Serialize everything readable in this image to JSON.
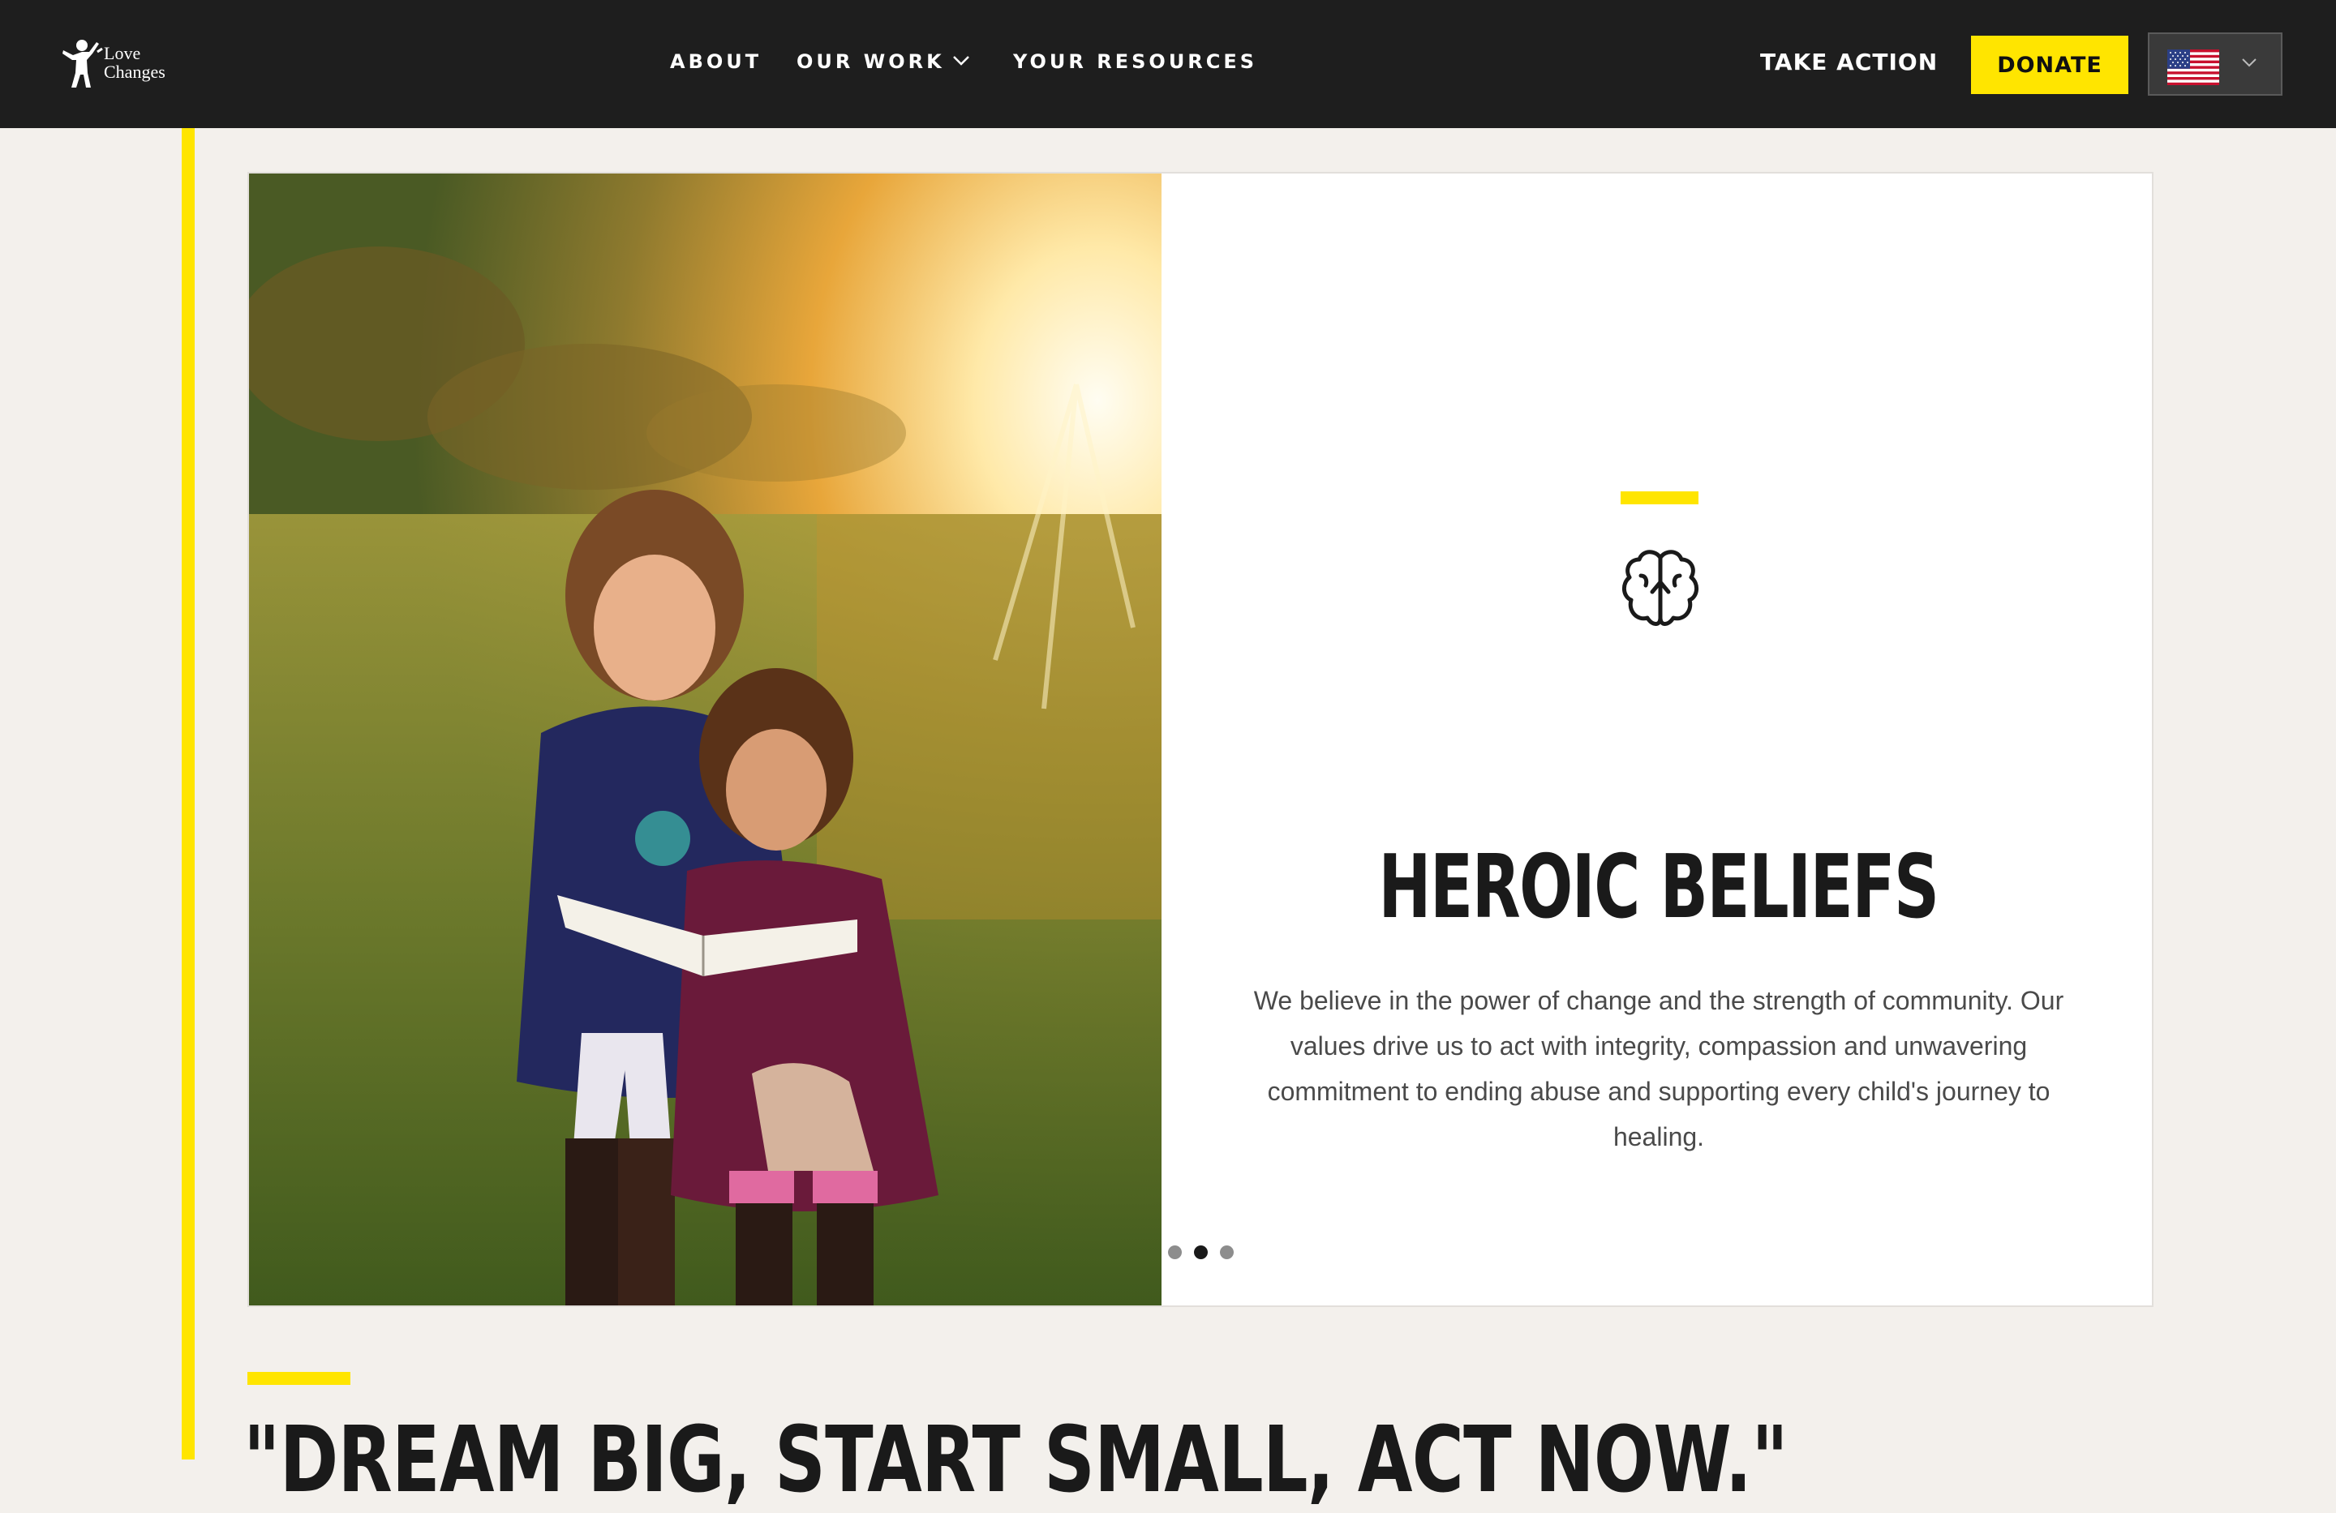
{
  "header": {
    "logo_line1": "Love",
    "logo_line2": "Changes",
    "nav": [
      {
        "label": "ABOUT"
      },
      {
        "label": "OUR WORK",
        "icon": "chevron-down-icon"
      },
      {
        "label": "YOUR RESOURCES"
      }
    ],
    "take_action_label": "TAKE ACTION",
    "donate_label": "DONATE",
    "language_flag": "us-flag-icon"
  },
  "slide": {
    "image": "two girls reading a book in a sunlit field",
    "icon": "brain-icon",
    "title": "HEROIC BELIEFS",
    "body": "We believe in the power of change and the strength of community. Our values drive us to act with integrity, compassion and unwavering commitment to ending abuse and supporting every child's journey to healing.",
    "dots": 3,
    "active_dot": 2
  },
  "quote": "\"DREAM BIG, START SMALL, ACT NOW.\"",
  "colors": {
    "accent": "#ffe500",
    "header_bg": "#1e1e1e",
    "page_bg": "#f3f0ec",
    "text_dark": "#1a1a1a",
    "text_body": "#4a4a4a"
  }
}
